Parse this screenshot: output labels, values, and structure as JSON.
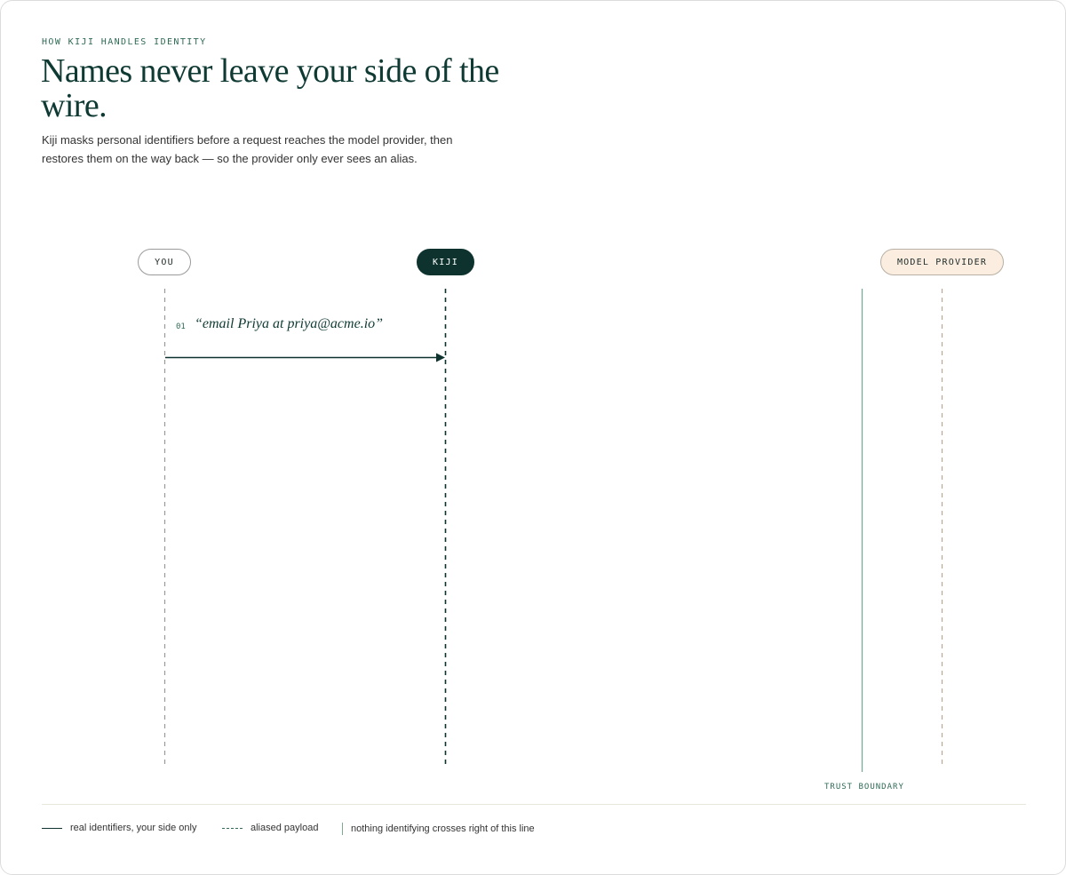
{
  "eyebrow": "HOW KIJI HANDLES IDENTITY",
  "headline": "Names never leave your side of the wire.",
  "subtitle": "Kiji masks personal identifiers before a request reaches the model provider, then restores them on the way back — so the provider only ever sees an alias.",
  "actors": {
    "you": "YOU",
    "kiji": "KIJI",
    "provider": "MODEL PROVIDER"
  },
  "steps": [
    {
      "number": "01",
      "message": "“email Priya at priya@acme.io”"
    }
  ],
  "trust_boundary_label": "TRUST BOUNDARY",
  "legend": {
    "real": "real identifiers, your side only",
    "aliased": "aliased payload",
    "boundary": "nothing identifying crosses right of this line"
  },
  "colors": {
    "ink": "#0e332f",
    "accent": "#2f6b55",
    "boundary": "#7bab95",
    "provider_fill": "#fbeee1"
  }
}
